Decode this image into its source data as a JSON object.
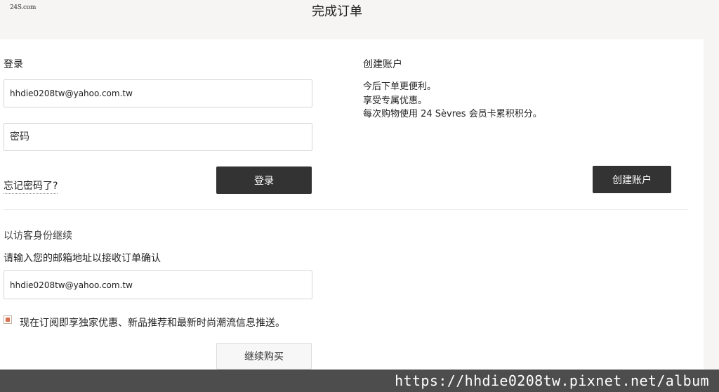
{
  "header": {
    "logo_text": "24S.com",
    "title": "完成订单"
  },
  "login": {
    "heading": "登录",
    "email_value": "hhdie0208tw@yahoo.com.tw",
    "password_placeholder": "密码",
    "forgot_label": "忘记密码了?",
    "login_button": "登录"
  },
  "create_account": {
    "heading": "创建账户",
    "benefits": [
      "今后下单更便利。",
      "享受专属优惠。",
      "每次购物使用 24 Sèvres 会员卡累积积分。"
    ],
    "button": "创建账户"
  },
  "guest": {
    "heading": "以访客身份继续",
    "prompt": "请输入您的邮箱地址以接收订单确认",
    "email_value": "hhdie0208tw@yahoo.com.tw",
    "subscribe_label": "现在订阅即享独家优惠、新品推荐和最新时尚潮流信息推送。",
    "subscribe_checked": true,
    "continue_button": "继续购买"
  },
  "watermark": {
    "text": "https://hhdie0208tw.pixnet.net/album"
  },
  "colors": {
    "accent": "#d9704d",
    "button_dark": "#333333",
    "page_bg": "#f6f5f3"
  }
}
